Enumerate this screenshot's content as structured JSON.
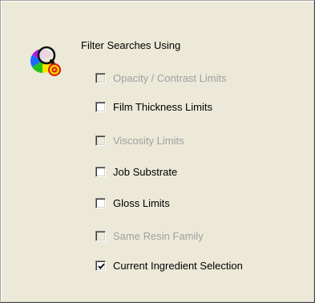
{
  "group": {
    "title": "Filter Searches Using",
    "icon": "color-wheel-magnifier-icon"
  },
  "options": [
    {
      "label": "Opacity / Contrast Limits",
      "checked": false,
      "enabled": false
    },
    {
      "label": "Film Thickness Limits",
      "checked": false,
      "enabled": true
    },
    {
      "label": "Viscosity Limits",
      "checked": false,
      "enabled": false
    },
    {
      "label": "Job Substrate",
      "checked": false,
      "enabled": true
    },
    {
      "label": "Gloss Limits",
      "checked": false,
      "enabled": true
    },
    {
      "label": "Same Resin Family",
      "checked": false,
      "enabled": false
    },
    {
      "label": "Current Ingredient Selection",
      "checked": true,
      "enabled": true
    }
  ],
  "colors": {
    "panel_bg": "#ece9d8",
    "disabled_text": "#a0a0a0",
    "enabled_text": "#000000"
  }
}
